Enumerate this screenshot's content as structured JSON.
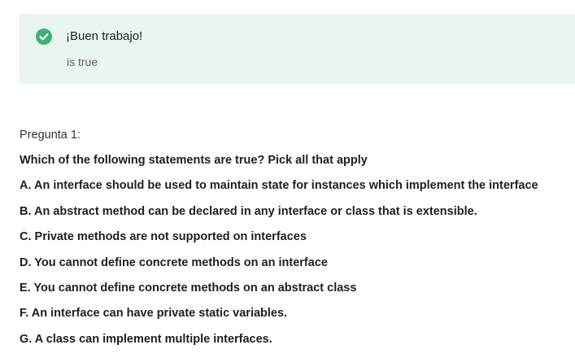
{
  "feedback": {
    "status": "correct",
    "icon": "check-circle-icon",
    "accent_color": "#3cb371",
    "background_color": "#e8f6ef",
    "title": "¡Buen trabajo!",
    "detail": "is true"
  },
  "question": {
    "number_label": "Pregunta 1:",
    "prompt": "Which of the following statements are true? Pick all that apply",
    "options": [
      {
        "label": "A. An interface should be used to maintain state for instances which implement the interface"
      },
      {
        "label": "B. An abstract method can be declared in any interface or class that is extensible."
      },
      {
        "label": "C. Private methods are not supported on interfaces"
      },
      {
        "label": "D. You cannot define concrete methods on an interface"
      },
      {
        "label": "E. You cannot define concrete methods on an abstract class"
      },
      {
        "label": "F. An interface can have private static variables."
      },
      {
        "label": "G. A class can implement multiple interfaces."
      }
    ]
  }
}
